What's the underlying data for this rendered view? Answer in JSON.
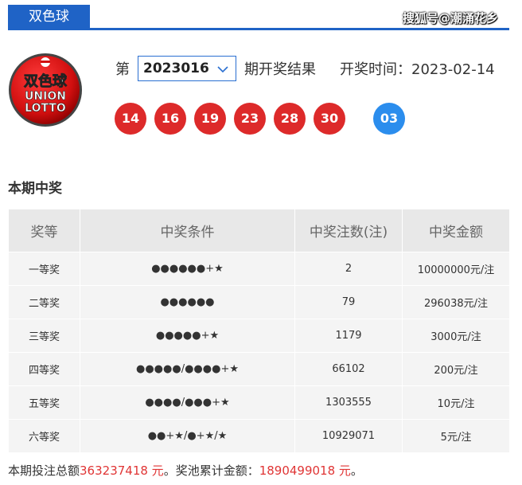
{
  "header": {
    "tab_label": "双色球",
    "watermark": "搜狐号@潮涌花乡"
  },
  "logo": {
    "top_text": "双色球",
    "line1": "UNION",
    "line2": "LOTTO"
  },
  "draw": {
    "prefix": "第",
    "issue": "2023016",
    "suffix": "期开奖结果",
    "time_label": "开奖时间：",
    "time_value": "2023-02-14"
  },
  "balls": {
    "red": [
      "14",
      "16",
      "19",
      "23",
      "28",
      "30"
    ],
    "blue": [
      "03"
    ]
  },
  "colors": {
    "brand_blue": "#1f63c6",
    "red_ball": "#dd2a2a",
    "blue_ball": "#2b8ded",
    "highlight_red": "#e03535"
  },
  "prize_section": {
    "title": "本期中奖"
  },
  "table": {
    "headers": [
      "奖等",
      "中奖条件",
      "中奖注数(注)",
      "中奖金额"
    ],
    "rows": [
      [
        "一等奖",
        "●●●●●●+★",
        "2",
        "10000000元/注"
      ],
      [
        "二等奖",
        "●●●●●●",
        "79",
        "296038元/注"
      ],
      [
        "三等奖",
        "●●●●●+★",
        "1179",
        "3000元/注"
      ],
      [
        "四等奖",
        "●●●●●/●●●●+★",
        "66102",
        "200元/注"
      ],
      [
        "五等奖",
        "●●●●/●●●+★",
        "1303555",
        "10元/注"
      ],
      [
        "六等奖",
        "●●+★/●+★/★",
        "10929071",
        "5元/注"
      ]
    ]
  },
  "footer": {
    "sales_label": "本期投注总额",
    "sales_value": "363237418 元",
    "pool_label": "。奖池累计金额：",
    "pool_value": "1890499018 元",
    "end": "。"
  }
}
